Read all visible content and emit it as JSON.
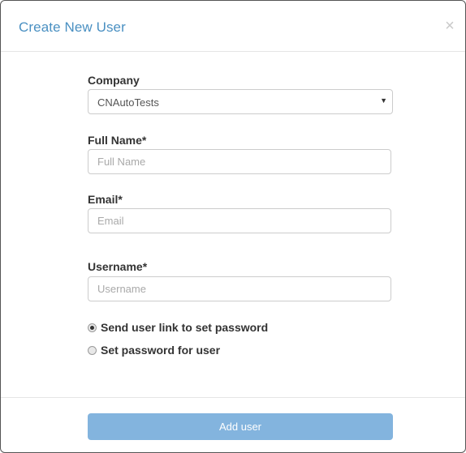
{
  "dialog": {
    "title": "Create New User",
    "close_glyph": "×"
  },
  "form": {
    "company": {
      "label": "Company",
      "selected": "CNAutoTests",
      "caret": "▼"
    },
    "full_name": {
      "label": "Full Name*",
      "value": "",
      "placeholder": "Full Name"
    },
    "email": {
      "label": "Email*",
      "value": "",
      "placeholder": "Email"
    },
    "username": {
      "label": "Username*",
      "value": "",
      "placeholder": "Username"
    },
    "password_options": [
      {
        "label": "Send user link to set password",
        "checked": true
      },
      {
        "label": "Set password for user",
        "checked": false
      }
    ]
  },
  "footer": {
    "submit_label": "Add user"
  },
  "colors": {
    "title": "#4a90c2",
    "button_bg": "#83b4de",
    "border": "#cccccc"
  },
  "icons": {
    "close": "close-icon",
    "dropdown": "chevron-down-icon"
  }
}
